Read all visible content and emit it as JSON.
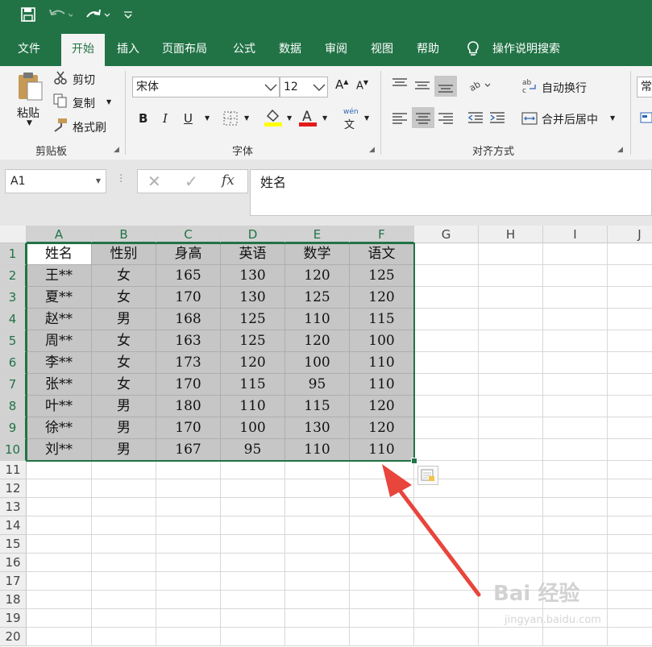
{
  "quick_access": {
    "save_icon": "save-icon",
    "undo_icon": "undo-icon",
    "redo_icon": "redo-icon",
    "customize_icon": "customize-icon"
  },
  "menu": {
    "tabs": [
      "文件",
      "开始",
      "插入",
      "页面布局",
      "公式",
      "数据",
      "审阅",
      "视图",
      "帮助"
    ],
    "active_tab": "开始",
    "tell_me": "操作说明搜索"
  },
  "ribbon": {
    "clipboard": {
      "paste": "粘贴",
      "cut": "剪切",
      "copy": "复制",
      "format_painter": "格式刷",
      "label": "剪贴板"
    },
    "font": {
      "font_name": "宋体",
      "font_size": "12",
      "bold": "B",
      "italic": "I",
      "underline": "U",
      "label": "字体",
      "phonetic": "wén"
    },
    "alignment": {
      "wrap_text": "自动换行",
      "merge_center": "合并后居中",
      "label": "对齐方式"
    },
    "number": {
      "format": "常"
    }
  },
  "formula_bar": {
    "name_box": "A1",
    "formula": "姓名",
    "fx": "fx"
  },
  "sheet": {
    "columns": [
      "A",
      "B",
      "C",
      "D",
      "E",
      "F",
      "G",
      "H",
      "I",
      "J"
    ],
    "rows": [
      "1",
      "2",
      "3",
      "4",
      "5",
      "6",
      "7",
      "8",
      "9",
      "10",
      "11",
      "12",
      "13",
      "14",
      "15",
      "16",
      "17",
      "18",
      "19",
      "20"
    ],
    "cells": [
      [
        "姓名",
        "性别",
        "身高",
        "英语",
        "数学",
        "语文"
      ],
      [
        "王**",
        "女",
        "165",
        "130",
        "120",
        "125"
      ],
      [
        "夏**",
        "女",
        "170",
        "130",
        "125",
        "120"
      ],
      [
        "赵**",
        "男",
        "168",
        "125",
        "110",
        "115"
      ],
      [
        "周**",
        "女",
        "163",
        "125",
        "120",
        "100"
      ],
      [
        "李**",
        "女",
        "173",
        "120",
        "100",
        "110"
      ],
      [
        "张**",
        "女",
        "170",
        "115",
        "95",
        "110"
      ],
      [
        "叶**",
        "男",
        "180",
        "110",
        "115",
        "120"
      ],
      [
        "徐**",
        "男",
        "170",
        "100",
        "130",
        "120"
      ],
      [
        "刘**",
        "男",
        "167",
        "95",
        "110",
        "110"
      ]
    ]
  },
  "watermark": {
    "text": "Bai 经验",
    "url": "jingyan.baidu.com"
  },
  "colors": {
    "excel_green": "#217346",
    "selection_fill": "#c6c6c6",
    "arrow_red": "#e8453c"
  }
}
